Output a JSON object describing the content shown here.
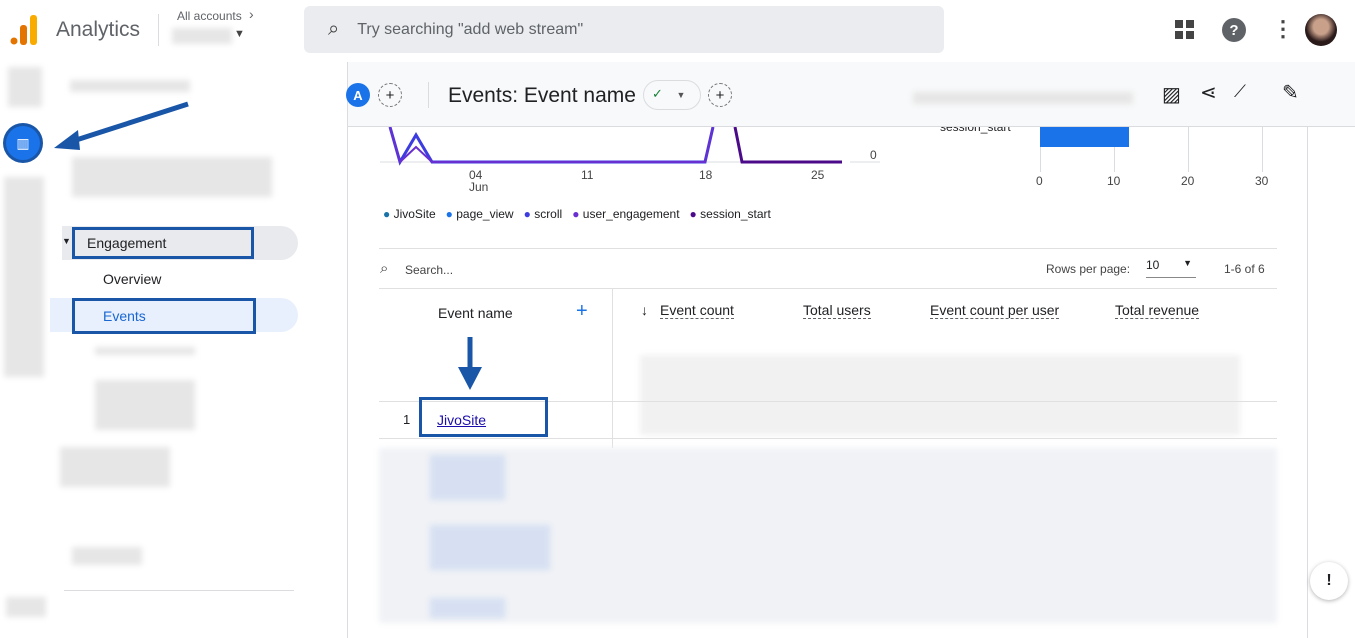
{
  "app": {
    "title": "Analytics",
    "accounts_label": "All accounts",
    "search_placeholder": "Try searching \"add web stream\""
  },
  "nav": {
    "section": "Engagement",
    "items": [
      {
        "label": "Overview"
      },
      {
        "label": "Events"
      }
    ]
  },
  "subheader": {
    "comparison_badge": "A",
    "title": "Events: Event name"
  },
  "line_chart": {
    "x_ticks": [
      "04",
      "11",
      "18",
      "25"
    ],
    "x_month": "Jun",
    "y_tick": "0",
    "legend": [
      {
        "name": "JivoSite",
        "color": "#1a73a8"
      },
      {
        "name": "page_view",
        "color": "#1a73e8"
      },
      {
        "name": "scroll",
        "color": "#3c3ce0"
      },
      {
        "name": "user_engagement",
        "color": "#6a2fd0"
      },
      {
        "name": "session_start",
        "color": "#4b0a8a"
      }
    ]
  },
  "bar_chart": {
    "label": "session_start",
    "value": 12,
    "x_ticks": [
      "0",
      "10",
      "20",
      "30"
    ],
    "max": 30,
    "color": "#1a73e8"
  },
  "table": {
    "search_placeholder": "Search...",
    "rows_per_page_label": "Rows per page:",
    "rows_per_page": "10",
    "pagination": "1-6 of 6",
    "columns": [
      "Event name",
      "Event count",
      "Total users",
      "Event count per user",
      "Total revenue"
    ],
    "rows": [
      {
        "index": "1",
        "event": "JivoSite"
      }
    ]
  }
}
